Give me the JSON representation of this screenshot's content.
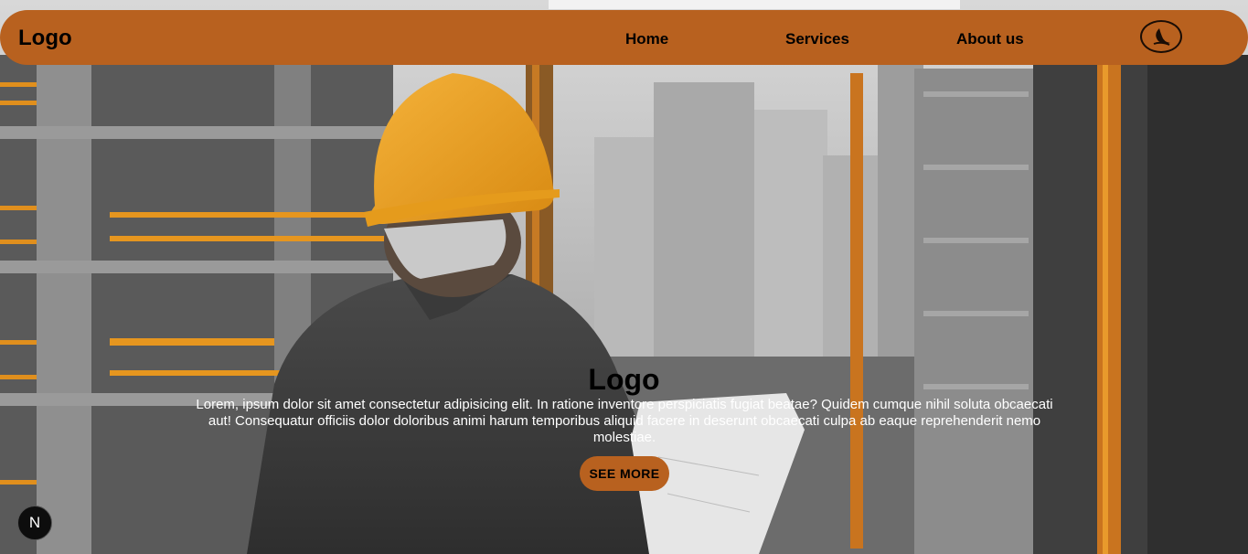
{
  "nav": {
    "logo": "Logo",
    "links": [
      {
        "label": "Home"
      },
      {
        "label": "Services"
      },
      {
        "label": "About us"
      }
    ],
    "theme_toggle_icon": "moon-icon"
  },
  "hero": {
    "title": "Logo",
    "description": "Lorem, ipsum dolor sit amet consectetur adipisicing elit. In ratione inventore perspiciatis fugiat beatae? Quidem cumque nihil soluta obcaecati aut! Consequatur officiis dolor doloribus animi harum temporibus aliquid facere in deserunt obcaecati culpa ab eaque reprehenderit nemo molestiae.",
    "button_label": "SEE MORE",
    "background_image": "construction-worker-hardhat-photo"
  },
  "dev_badge": {
    "label": "N"
  },
  "colors": {
    "accent": "#b8611f",
    "text_dark": "#000000",
    "text_light": "#ffffff"
  }
}
